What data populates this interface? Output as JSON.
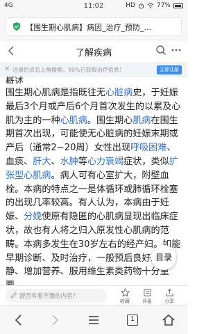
{
  "status_bar": {
    "signal": "4G",
    "time": "11:02",
    "right": "HD",
    "battery": "77%"
  },
  "address_bar": {
    "url": "【围生期心肌病】病因_治疗_预防_..."
  },
  "page_header": {
    "title": "了解疾病"
  },
  "notice": {
    "text": "注册后点右上角搜索，90%已获取治疗信息！",
    "button": "立即注册"
  },
  "section_title": "概述",
  "article": {
    "segments": [
      {
        "t": "围生期心肌病是指既往无"
      },
      {
        "t": "心脏病",
        "link": true
      },
      {
        "t": "史，于妊娠最后3个月或产后6个月首次发生的以累及心肌为主的一种"
      },
      {
        "t": "心肌病",
        "link": true
      },
      {
        "t": "。围生期心"
      },
      {
        "t": "肌病",
        "link": true
      },
      {
        "t": "在围生期首次出现，可能使无心脏病的妊娠末期或产后（通常2~20周）女性出现"
      },
      {
        "t": "呼吸困难",
        "link": true
      },
      {
        "t": "、血痰、"
      },
      {
        "t": "肝大",
        "link": true
      },
      {
        "t": "、"
      },
      {
        "t": "水肿",
        "link": true
      },
      {
        "t": "等"
      },
      {
        "t": "心力衰竭",
        "link": true
      },
      {
        "t": "症状，类似"
      },
      {
        "t": "扩张型心肌病",
        "link": true
      },
      {
        "t": "。病人可有心室扩大，附壁血栓。本病的特点之一是体循环或肺循环栓塞的出现几率较高。有人认为，本病由于妊娠、"
      },
      {
        "t": "分娩",
        "link": true
      },
      {
        "t": "使原有隐匿的心肌病显现出临床症状，故也有人将之归入原发性心肌病的范畴。本病多发生在30岁左右的经产妇。如能早期诊断、及时治疗，一般预后良好。安静、增加营养、服用维生素类药物十分重要。"
      }
    ]
  },
  "toc_button": "目录",
  "comment_bar": {
    "placeholder": "提否有看不懂的内容？",
    "actions": [
      {
        "label": "收藏",
        "icon": "star-icon"
      },
      {
        "label": "评星",
        "icon": "rate-icon"
      },
      {
        "label": "分享",
        "icon": "share-icon"
      }
    ]
  },
  "browser_nav": {
    "tabs_count": "1"
  },
  "colors": {
    "link": "#2a6fdb",
    "accent": "#3d8cf0",
    "secure_green": "#27ae60"
  }
}
